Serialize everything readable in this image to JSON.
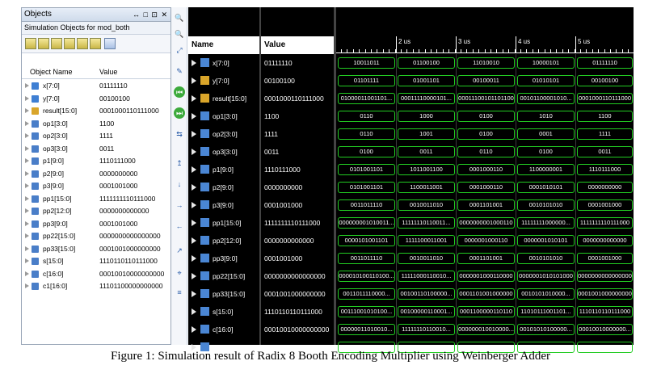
{
  "objects_panel": {
    "title": "Objects",
    "window_controls": "↔ □ ⊡ ✕",
    "subtitle": "Simulation Objects for mod_both",
    "columns": {
      "name": "Object Name",
      "value": "Value"
    },
    "rows": [
      {
        "name": "x[7:0]",
        "value": "01111110",
        "icon": "input-bus-icon"
      },
      {
        "name": "y[7:0]",
        "value": "00100100",
        "icon": "input-bus-icon"
      },
      {
        "name": "result[15:0]",
        "value": "0001000110111000",
        "icon": "output-bus-icon"
      },
      {
        "name": "op1[3:0]",
        "value": "1100",
        "icon": "bus-icon"
      },
      {
        "name": "op2[3:0]",
        "value": "1111",
        "icon": "bus-icon"
      },
      {
        "name": "op3[3:0]",
        "value": "0011",
        "icon": "bus-icon"
      },
      {
        "name": "p1[9:0]",
        "value": "1110111000",
        "icon": "bus-icon"
      },
      {
        "name": "p2[9:0]",
        "value": "0000000000",
        "icon": "bus-icon"
      },
      {
        "name": "p3[9:0]",
        "value": "0001001000",
        "icon": "bus-icon"
      },
      {
        "name": "pp1[15:0]",
        "value": "1111111110111000",
        "icon": "bus-icon"
      },
      {
        "name": "pp2[12:0]",
        "value": "0000000000000",
        "icon": "bus-icon"
      },
      {
        "name": "pp3[9:0]",
        "value": "0001001000",
        "icon": "bus-icon"
      },
      {
        "name": "pp22[15:0]",
        "value": "0000000000000000",
        "icon": "bus-icon"
      },
      {
        "name": "pp33[15:0]",
        "value": "0001001000000000",
        "icon": "bus-icon"
      },
      {
        "name": "s[15:0]",
        "value": "1110110110111000",
        "icon": "bus-icon"
      },
      {
        "name": "c[16:0]",
        "value": "00010010000000000",
        "icon": "bus-icon"
      },
      {
        "name": "c1[16:0]",
        "value": "11101100000000000",
        "icon": "bus-icon"
      }
    ]
  },
  "vertical_toolbar_icons": [
    "zoom-in-icon",
    "zoom-out-icon",
    "zoom-fit-icon",
    "marker-icon",
    "go-start-icon",
    "go-end-icon",
    "swap-icon",
    "snap-icon",
    "cursor-down-icon",
    "cursor-right-icon",
    "cursor-left-icon",
    "expand-icon",
    "cursor-icon",
    "list-icon"
  ],
  "wave": {
    "name_header": "Name",
    "value_header": "Value",
    "ruler_labels": [
      "2 us",
      "3 us",
      "4 us",
      "5 us"
    ],
    "signals": [
      {
        "name": "x[7:0]",
        "value": "01111110",
        "out": false,
        "segments": [
          "10011011",
          "01100100",
          "11010010",
          "10000101",
          "01111110"
        ]
      },
      {
        "name": "y[7:0]",
        "value": "00100100",
        "out": true,
        "segments": [
          "01101111",
          "01001101",
          "00100011",
          "01010101",
          "00100100"
        ]
      },
      {
        "name": "result[15:0]",
        "value": "0001000110111000",
        "out": true,
        "segments": [
          "01000011001101...",
          "00011110000101...",
          "00011100101101100",
          "00101100001010...",
          "0001000110111000"
        ]
      },
      {
        "name": "op1[3:0]",
        "value": "1100",
        "out": false,
        "segments": [
          "0110",
          "1000",
          "0100",
          "1010",
          "1100"
        ]
      },
      {
        "name": "op2[3:0]",
        "value": "1111",
        "out": false,
        "segments": [
          "0110",
          "1001",
          "0100",
          "0001",
          "1111"
        ]
      },
      {
        "name": "op3[3:0]",
        "value": "0011",
        "out": false,
        "segments": [
          "0100",
          "0011",
          "0110",
          "0100",
          "0011"
        ]
      },
      {
        "name": "p1[9:0]",
        "value": "1110111000",
        "out": false,
        "segments": [
          "0101001101",
          "1011001100",
          "0001000110",
          "1100000001",
          "1110111000"
        ]
      },
      {
        "name": "p2[9:0]",
        "value": "0000000000",
        "out": false,
        "segments": [
          "0101001101",
          "1100011001",
          "0001000110",
          "0001010101",
          "0000000000"
        ]
      },
      {
        "name": "p3[9:0]",
        "value": "0001001000",
        "out": false,
        "segments": [
          "0011011110",
          "0010011010",
          "0001101001",
          "0010101010",
          "0001001000"
        ]
      },
      {
        "name": "pp1[15:0]",
        "value": "1111111110111000",
        "out": false,
        "segments": [
          "000000001010011...",
          "11111110110011...",
          "0000000001000110",
          "11111111000000...",
          "1111111110111000"
        ]
      },
      {
        "name": "pp2[12:0]",
        "value": "0000000000000",
        "out": false,
        "segments": [
          "0000101001101",
          "1111100011001",
          "0000001000110",
          "0000001010101",
          "0000000000000"
        ]
      },
      {
        "name": "pp3[9:0]",
        "value": "0001001000",
        "out": false,
        "segments": [
          "0011011110",
          "0010011010",
          "0001101001",
          "0010101010",
          "0001001000"
        ]
      },
      {
        "name": "pp22[15:0]",
        "value": "0000000000000000",
        "out": false,
        "segments": [
          "000010100110100...",
          "11111000110010...",
          "0000001000110000",
          "0000001010101000",
          "0000000000000000"
        ]
      },
      {
        "name": "pp33[15:0]",
        "value": "0001001000000000",
        "out": false,
        "segments": [
          "0011011110000...",
          "00100110100000...",
          "0001101001000000",
          "0010101010000...",
          "0001001000000000"
        ]
      },
      {
        "name": "s[15:0]",
        "value": "1110110110111000",
        "out": false,
        "segments": [
          "00111001010100...",
          "00100000110001...",
          "0001100000110110",
          "11010111001101...",
          "1110110110111000"
        ]
      },
      {
        "name": "c[16:0]",
        "value": "00010010000000000",
        "out": false,
        "segments": [
          "00000011010010...",
          "11111110110010...",
          "000000010010000...",
          "00101010100000...",
          "00010010000000..."
        ]
      },
      {
        "name": "c1[16:0]",
        "value": "11101100000000000",
        "out": false,
        "segments": [
          "00111100100000...",
          "11100001100000...",
          "000000000000000...",
          "11010111000000...",
          "11101100000000..."
        ]
      }
    ]
  },
  "caption": "Figure 1: Simulation result of Radix 8 Booth Encoding Multiplier using Weinberger Adder"
}
